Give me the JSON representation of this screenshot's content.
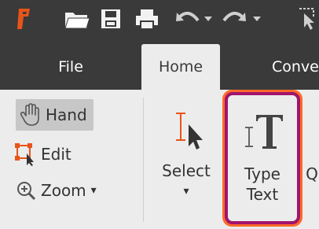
{
  "colors": {
    "titlebar_bg": "#3a3a3a",
    "ribbon_bg": "#ececec",
    "accent_orange": "#e8541a",
    "highlight_outer": "#ff6a2a",
    "highlight_inner": "#a0146b"
  },
  "quick_access": {
    "icons": [
      "app-logo-icon",
      "open-folder-icon",
      "save-icon",
      "print-icon",
      "undo-icon",
      "undo-dropdown-icon",
      "redo-icon",
      "redo-dropdown-icon",
      "cursor-icon"
    ]
  },
  "tabs": [
    {
      "label": "File"
    },
    {
      "label": "Home"
    },
    {
      "label": "Conve"
    }
  ],
  "tools": {
    "hand": {
      "label": "Hand"
    },
    "edit": {
      "label": "Edit"
    },
    "zoom": {
      "label": "Zoom",
      "dropdown": "▾"
    }
  },
  "select": {
    "label": "Select",
    "dropdown": "▾"
  },
  "type_text": {
    "line1": "Type",
    "line2": "Text"
  },
  "next_cut": {
    "label": "Q"
  }
}
